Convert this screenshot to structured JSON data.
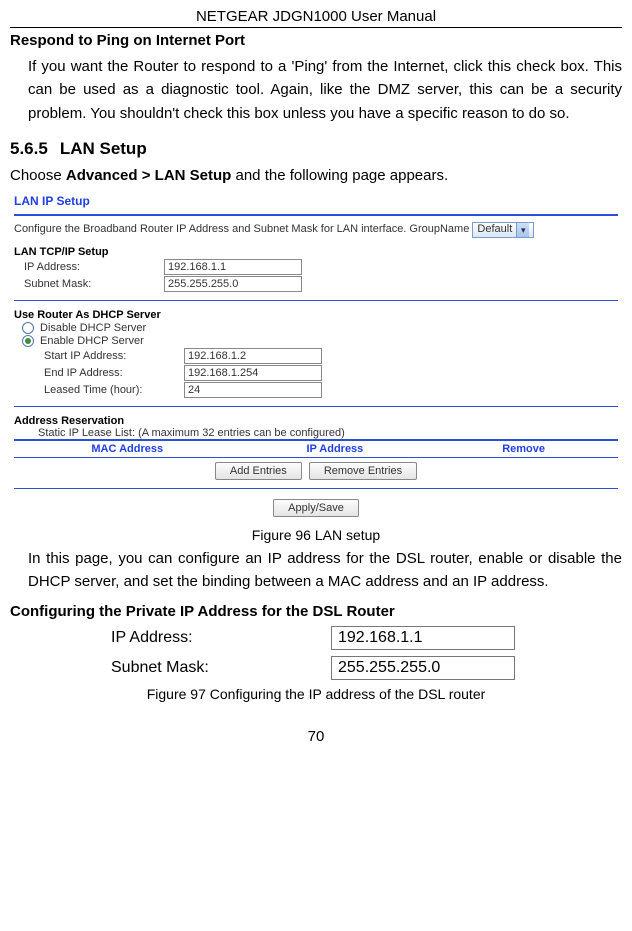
{
  "doc_title": "NETGEAR JDGN1000 User Manual",
  "section_ping": {
    "heading": "Respond to Ping on Internet Port",
    "body": "If you want the Router to respond to a 'Ping' from the Internet, click this check box. This can be used as a diagnostic tool. Again, like the DMZ server, this can be a security problem. You shouldn't check this box unless you have a specific reason to do so."
  },
  "section_lan": {
    "number": "5.6.5",
    "title": "LAN Setup",
    "instruction_pre": "Choose ",
    "instruction_strong": "Advanced > LAN Setup",
    "instruction_post": " and the following page appears."
  },
  "router": {
    "title": "LAN IP Setup",
    "config_text_pre": "Configure the Broadband Router IP Address and Subnet Mask for LAN interface. GroupName ",
    "groupname_value": "Default",
    "tcpip_heading": "LAN TCP/IP Setup",
    "ip_label": "IP Address:",
    "ip_value": "192.168.1.1",
    "mask_label": "Subnet Mask:",
    "mask_value": "255.255.255.0",
    "dhcp_heading": "Use Router As DHCP Server",
    "dhcp_disable": "Disable DHCP Server",
    "dhcp_enable": "Enable DHCP Server",
    "start_label": "Start IP Address:",
    "start_value": "192.168.1.2",
    "end_label": "End IP Address:",
    "end_value": "192.168.1.254",
    "lease_label": "Leased Time (hour):",
    "lease_value": "24",
    "addr_res_heading": "Address Reservation",
    "addr_res_note": "Static IP Lease List: (A maximum 32 entries can be configured)",
    "th_mac": "MAC Address",
    "th_ip": "IP Address",
    "th_remove": "Remove",
    "btn_add": "Add Entries",
    "btn_remove": "Remove Entries",
    "btn_apply": "Apply/Save"
  },
  "fig96_caption": "Figure 96 LAN setup",
  "after_fig96": "In this page, you can configure an IP address for the DSL router, enable or disable the DHCP server, and set the binding between a MAC address and an IP address.",
  "section_private_heading": "Configuring the Private IP Address for the DSL Router",
  "fig97": {
    "ip_label": "IP Address:",
    "ip_value": "192.168.1.1",
    "mask_label": "Subnet Mask:",
    "mask_value": "255.255.255.0"
  },
  "fig97_caption": "Figure 97 Configuring the IP address of the DSL router",
  "page_number": "70"
}
